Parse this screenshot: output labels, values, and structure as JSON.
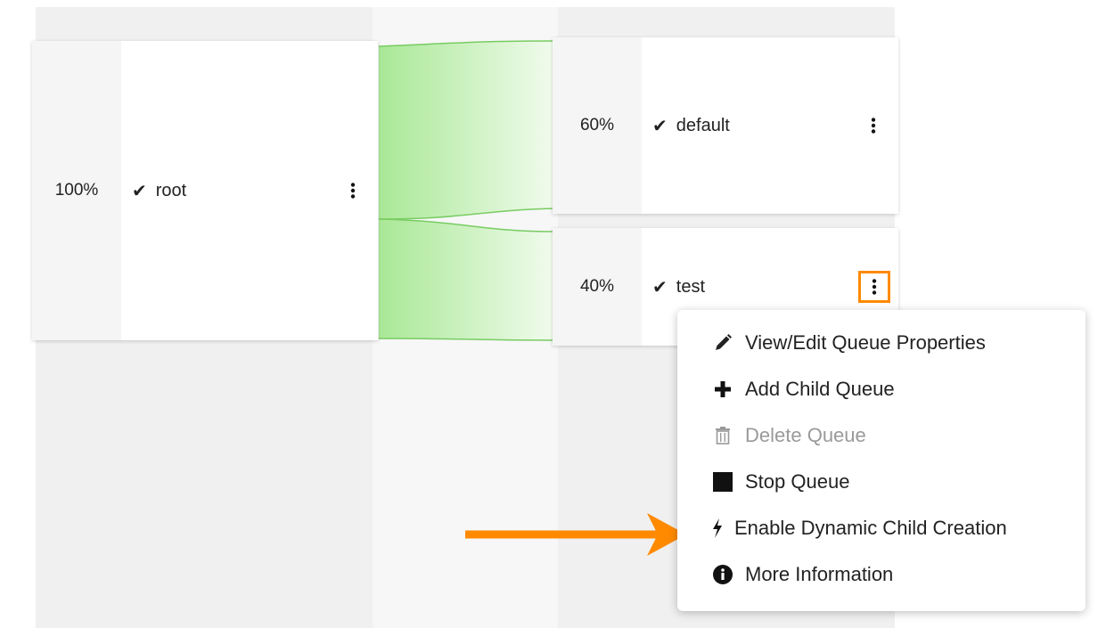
{
  "root_queue": {
    "percent": "100%",
    "name": "root"
  },
  "child_queues": [
    {
      "percent": "60%",
      "name": "default"
    },
    {
      "percent": "40%",
      "name": "test"
    }
  ],
  "context_menu": {
    "items": [
      {
        "label": "View/Edit Queue Properties",
        "icon": "pencil-icon",
        "enabled": true
      },
      {
        "label": "Add Child Queue",
        "icon": "plus-icon",
        "enabled": true
      },
      {
        "label": "Delete Queue",
        "icon": "trash-icon",
        "enabled": false
      },
      {
        "label": "Stop Queue",
        "icon": "stop-square-icon",
        "enabled": true
      },
      {
        "label": "Enable Dynamic Child Creation",
        "icon": "lightning-bolt-icon",
        "enabled": true
      },
      {
        "label": "More Information",
        "icon": "info-circle-icon",
        "enabled": true
      }
    ]
  },
  "colors": {
    "flow_fill": "#b9efa7",
    "flow_stroke": "#78cc62",
    "highlight": "#ff8a00",
    "column_bg": "#f0f0f0"
  }
}
